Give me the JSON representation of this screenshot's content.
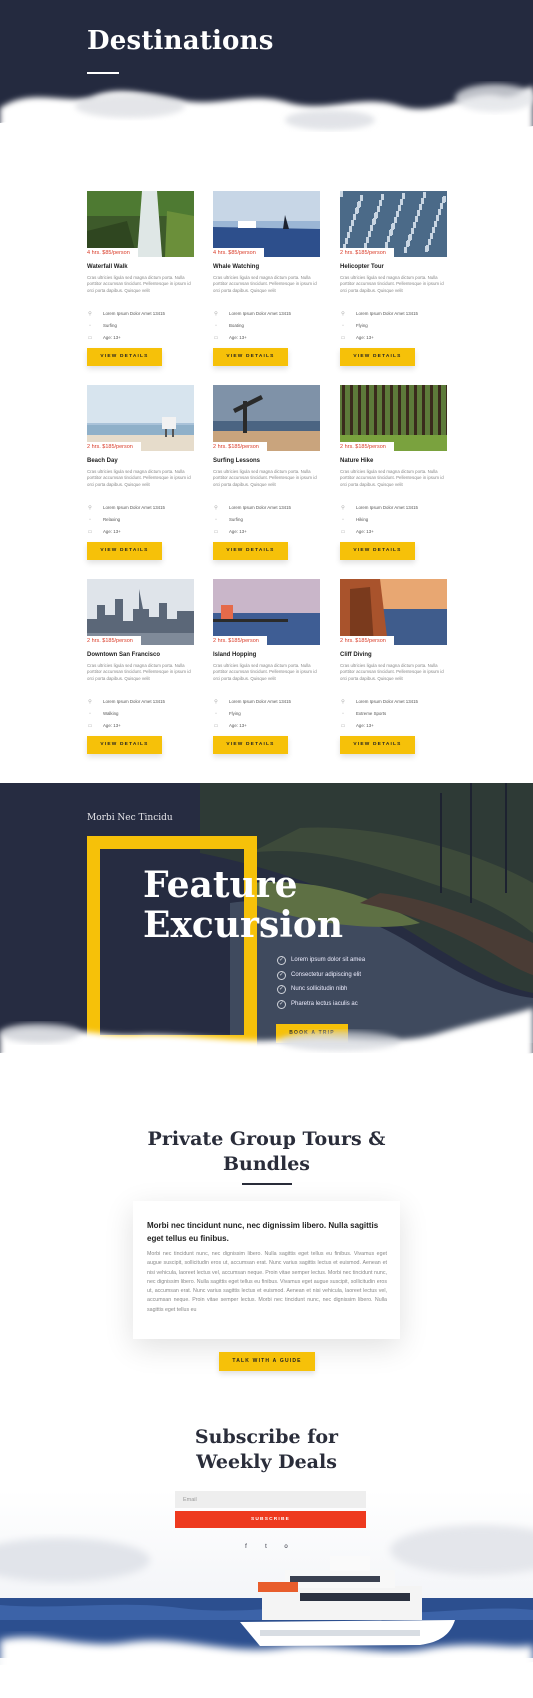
{
  "hero": {
    "title": "Destinations"
  },
  "tours": [
    {
      "price": "4 hrs. $85/person",
      "name": "Waterfall Walk",
      "description": "Cras ultricies ligula sed magna dictum porta. Nulla porttitor accumsan tincidunt. Pellentesque in ipsum id orci porta dapibus. Quisque velit",
      "location": "Lorem Ipsum Dolor Amet 13415",
      "category": "Surfing",
      "age": "Age: 13+",
      "button": "VIEW DETAILS",
      "scene": "waterfall"
    },
    {
      "price": "4 hrs. $85/person",
      "name": "Whale Watching",
      "description": "Cras ultricies ligula sed magna dictum porta. Nulla porttitor accumsan tincidunt. Pellentesque in ipsum id orci porta dapibus. Quisque velit",
      "location": "Lorem Ipsum Dolor Amet 13415",
      "category": "Boating",
      "age": "Age: 13+",
      "button": "VIEW DETAILS",
      "scene": "whale"
    },
    {
      "price": "2 hrs. $185/person",
      "name": "Helicopter Tour",
      "description": "Cras ultricies ligula sed magna dictum porta. Nulla porttitor accumsan tincidunt. Pellentesque in ipsum id orci porta dapibus. Quisque velit",
      "location": "Lorem Ipsum Dolor Amet 13415",
      "category": "Flying",
      "age": "Age: 13+",
      "button": "VIEW DETAILS",
      "scene": "city"
    },
    {
      "price": "2 hrs. $185/person",
      "name": "Beach Day",
      "description": "Cras ultricies ligula sed magna dictum porta. Nulla porttitor accumsan tincidunt. Pellentesque in ipsum id orci porta dapibus. Quisque velit",
      "location": "Lorem Ipsum Dolor Amet 13415",
      "category": "Relaxing",
      "age": "Age: 13+",
      "button": "VIEW DETAILS",
      "scene": "beach"
    },
    {
      "price": "2 hrs. $185/person",
      "name": "Surfing Lessons",
      "description": "Cras ultricies ligula sed magna dictum porta. Nulla porttitor accumsan tincidunt. Pellentesque in ipsum id orci porta dapibus. Quisque velit",
      "location": "Lorem Ipsum Dolor Amet 13415",
      "category": "Surfing",
      "age": "Age: 13+",
      "button": "VIEW DETAILS",
      "scene": "surf"
    },
    {
      "price": "2 hrs. $185/person",
      "name": "Nature Hike",
      "description": "Cras ultricies ligula sed magna dictum porta. Nulla porttitor accumsan tincidunt. Pellentesque in ipsum id orci porta dapibus. Quisque velit",
      "location": "Lorem Ipsum Dolor Amet 13415",
      "category": "Hiking",
      "age": "Age: 13+",
      "button": "VIEW DETAILS",
      "scene": "forest"
    },
    {
      "price": "2 hrs. $185/person",
      "name": "Downtown San Francisco",
      "description": "Cras ultricies ligula sed magna dictum porta. Nulla porttitor accumsan tincidunt. Pellentesque in ipsum id orci porta dapibus. Quisque velit",
      "location": "Lorem Ipsum Dolor Amet 13415",
      "category": "Walking",
      "age": "Age: 13+",
      "button": "VIEW DETAILS",
      "scene": "skyline"
    },
    {
      "price": "2 hrs. $185/person",
      "name": "Island Hopping",
      "description": "Cras ultricies ligula sed magna dictum porta. Nulla porttitor accumsan tincidunt. Pellentesque in ipsum id orci porta dapibus. Quisque velit",
      "location": "Lorem Ipsum Dolor Amet 13415",
      "category": "Flying",
      "age": "Age: 13+",
      "button": "VIEW DETAILS",
      "scene": "pier"
    },
    {
      "price": "2 hrs. $185/person",
      "name": "Cliff Diving",
      "description": "Cras ultricies ligula sed magna dictum porta. Nulla porttitor accumsan tincidunt. Pellentesque in ipsum id orci porta dapibus. Quisque velit",
      "location": "Lorem Ipsum Dolor Amet 13415",
      "category": "Extreme Sports",
      "age": "Age: 13+",
      "button": "VIEW DETAILS",
      "scene": "cliff"
    }
  ],
  "feature": {
    "kicker": "Morbi Nec Tincidu",
    "title_line1": "Feature",
    "title_line2": "Excursion",
    "items": [
      "Lorem ipsum dolor sit amea",
      "Consectetur adipiscing elit",
      "Nunc sollicitudin nibh",
      "Pharetra lectus iaculis ac"
    ],
    "button": "BOOK A TRIP"
  },
  "private": {
    "title_line1": "Private Group Tours &",
    "title_line2": "Bundles",
    "heading": "Morbi nec tincidunt nunc, nec dignissim libero. Nulla sagittis eget tellus eu finibus.",
    "body": "Morbi nec tincidunt nunc, nec dignissim libero. Nulla sagittis eget tellus eu finibus. Vivamus eget augue suscipit, sollicitudin eros ut, accumsan erat. Nunc varius sagittis lectus et euismod. Aenean et nisi vehicula, laoreet lectus vel, accumsan neque. Proin vitae semper lectus. Morbi nec tincidunt nunc, nec dignissim libero. Nulla sagittis eget tellus eu finibus. Vivamus eget augue suscipit, sollicitudin eros ut, accumsan erat. Nunc varius sagittis lectus et euismod. Aenean et nisi vehicula, laoreet lectus vel, accumsan neque. Proin vitae semper lectus. Morbi nec tincidunt nunc, nec dignissim libero. Nulla sagittis eget tellus eu",
    "button": "TALK WITH A GUIDE"
  },
  "subscribe": {
    "title_line1": "Subscribe for",
    "title_line2": "Weekly Deals",
    "email_placeholder": "Email",
    "button": "SUBSCRIBE",
    "social": [
      "f",
      "t",
      "o"
    ]
  },
  "colors": {
    "navy": "#242a3f",
    "accent": "#f6c109",
    "price_red": "#d93a26",
    "subscribe_red": "#ee3a1f"
  }
}
